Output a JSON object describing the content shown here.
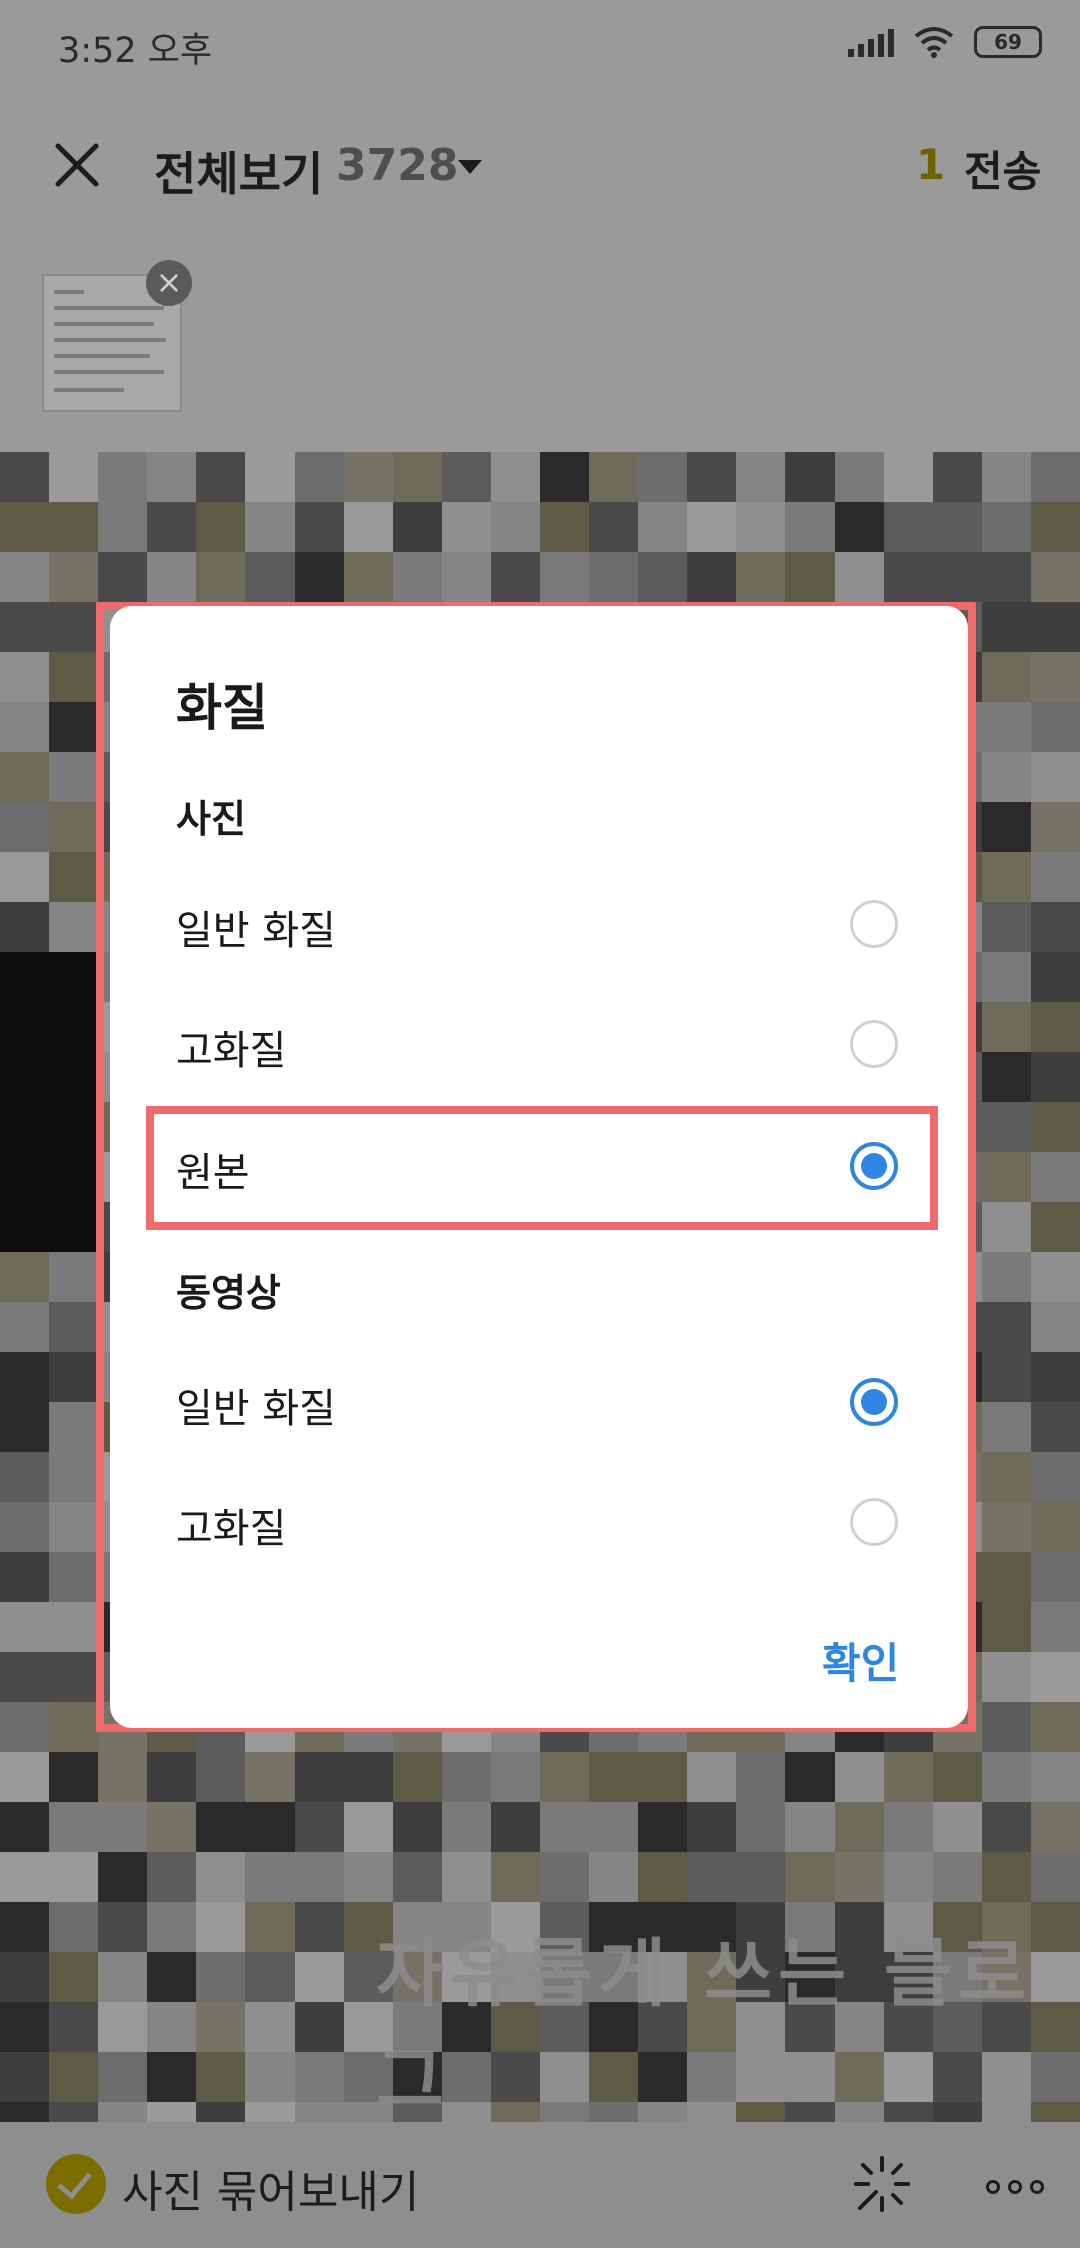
{
  "status": {
    "time": "3:52 오후",
    "battery": "69"
  },
  "header": {
    "title": "전체보기",
    "count": "3728",
    "selected_count": "1",
    "send_label": "전송"
  },
  "gallery": {
    "watermark": "자유롭게 쓰는 블로그"
  },
  "bottom": {
    "bundle_label": "사진 묶어보내기"
  },
  "dialog": {
    "title": "화질",
    "photo_section": "사진",
    "photo_options": [
      {
        "label": "일반 화질",
        "selected": false
      },
      {
        "label": "고화질",
        "selected": false
      },
      {
        "label": "원본",
        "selected": true
      }
    ],
    "video_section": "동영상",
    "video_options": [
      {
        "label": "일반 화질",
        "selected": true
      },
      {
        "label": "고화질",
        "selected": false
      }
    ],
    "confirm_label": "확인"
  },
  "colors": {
    "accent": "#2f86e0",
    "highlight": "#ef6b6b",
    "selected_badge": "#7c6d00"
  }
}
